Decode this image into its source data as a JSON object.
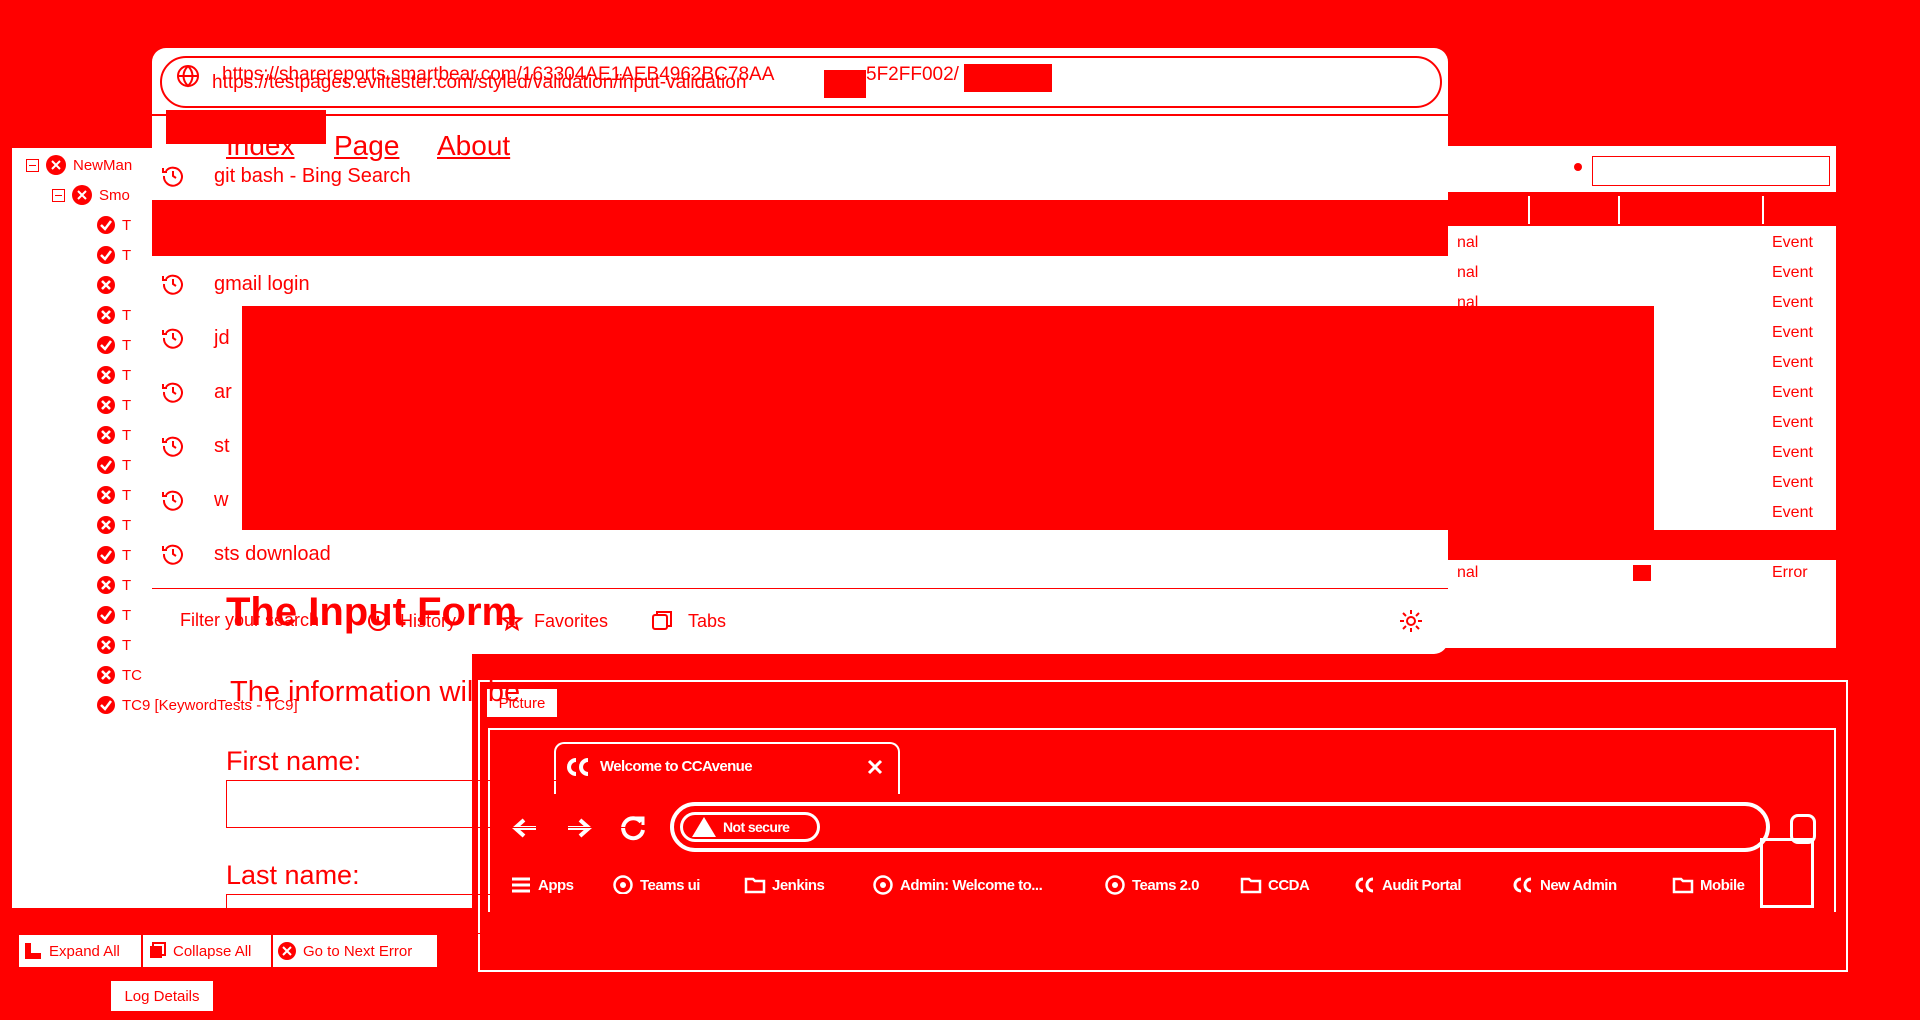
{
  "browser_overlay": {
    "url_primary": "https://sharereports.smartbear.com/163304AE1AEB4962BC78AA",
    "url_primary_tail": "5F2FF002/",
    "url_overlap": "https://testpages.eviltester.com/styled/validation/input-validation",
    "history_items": [
      "git bash - Bing Search",
      "gmail login",
      "jd",
      "ar",
      "st",
      "w",
      "sts download"
    ],
    "footer": {
      "filter": "Filter your search",
      "history": "History",
      "favorites": "Favorites",
      "tabs": "Tabs"
    }
  },
  "test_page": {
    "nav": [
      "Index",
      "Page",
      "About"
    ],
    "form_title": "The Input Form",
    "form_subtitle": "The information will be",
    "first_name_label": "First name:",
    "last_name_label": "Last name:"
  },
  "log_tree": {
    "root": "NewMan",
    "suite": "Smo",
    "items": [
      {
        "status": "pass",
        "label": "T"
      },
      {
        "status": "pass",
        "label": "T"
      },
      {
        "status": "fail",
        "label": ""
      },
      {
        "status": "fail",
        "label": "T"
      },
      {
        "status": "pass",
        "label": "T"
      },
      {
        "status": "fail",
        "label": "T"
      },
      {
        "status": "fail",
        "label": "T"
      },
      {
        "status": "fail",
        "label": "T"
      },
      {
        "status": "pass",
        "label": "T"
      },
      {
        "status": "fail",
        "label": "T"
      },
      {
        "status": "fail",
        "label": "T"
      },
      {
        "status": "pass",
        "label": "T"
      },
      {
        "status": "fail",
        "label": "T"
      },
      {
        "status": "pass",
        "label": "T"
      },
      {
        "status": "fail",
        "label": "T"
      },
      {
        "status": "fail",
        "label": "TC"
      },
      {
        "status": "pass",
        "label": "TC9 [KeywordTests - TC9]"
      }
    ],
    "buttons": {
      "expand": "Expand All",
      "collapse": "Collapse All",
      "next_error": "Go to Next Error"
    },
    "bottom_tab": "Log Details"
  },
  "log_grid": {
    "type_col": [
      "nal",
      "nal",
      "nal",
      "",
      "",
      "",
      "",
      "",
      "",
      ""
    ],
    "event_rows": [
      "Event",
      "Event",
      "Event",
      "Event",
      "Event",
      "Event",
      "Event",
      "Event",
      "Event",
      "Event"
    ],
    "error_row": {
      "type": "nal",
      "status": "Error"
    }
  },
  "picture_panel": {
    "tab_label": "Picture",
    "inner_tab_title": "Welcome to CCAvenue",
    "warning_text": "Not secure",
    "bookmarks": [
      "Apps",
      "Teams ui",
      "Jenkins",
      "Admin: Welcome to...",
      "Teams 2.0",
      "CCDA",
      "Audit Portal",
      "New Admin",
      "Mobile"
    ]
  },
  "colors": {
    "background": "#ff0000",
    "foreground": "#ffffff"
  }
}
